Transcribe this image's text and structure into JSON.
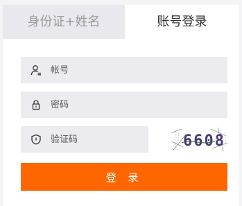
{
  "tabs": {
    "id_name": "身份证+姓名",
    "account": "账号登录"
  },
  "form": {
    "account_placeholder": "帐号",
    "password_placeholder": "密码",
    "captcha_placeholder": "验证码",
    "captcha_text": "6608"
  },
  "login_button": "登 录",
  "icons": {
    "account": "user-icon",
    "password": "lock-icon",
    "captcha": "shield-icon"
  },
  "colors": {
    "accent": "#ff6600",
    "field_bg": "#ebebf0",
    "inactive_tab_bg": "#e8e8ee"
  }
}
